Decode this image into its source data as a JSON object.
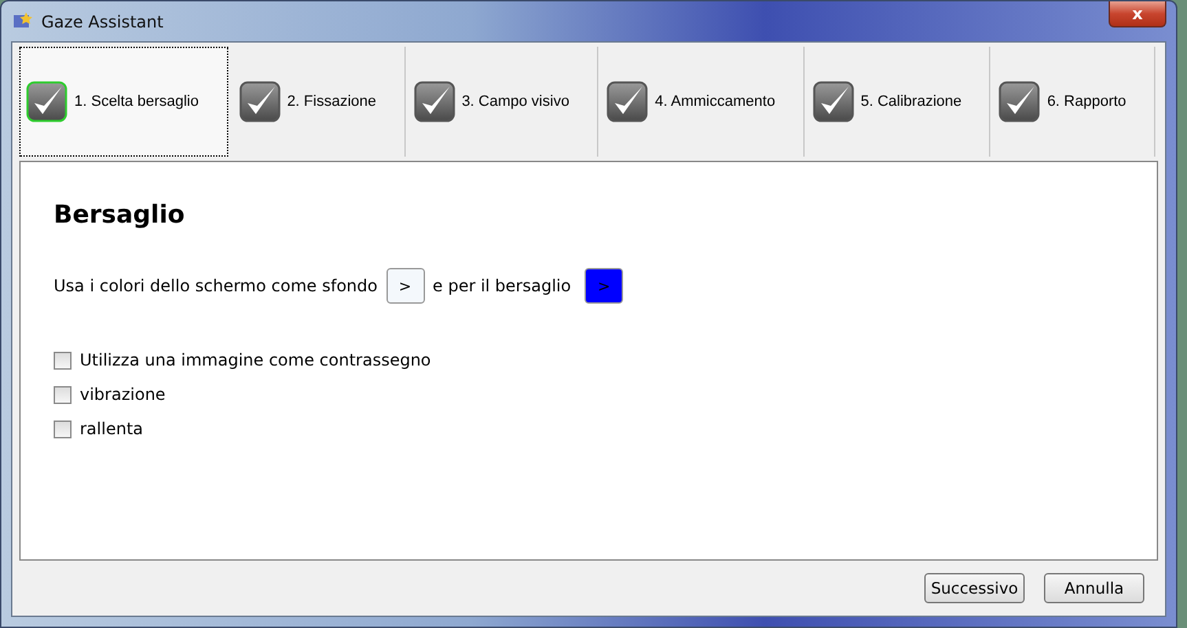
{
  "window": {
    "title": "Gaze Assistant",
    "close": "x"
  },
  "steps": [
    {
      "label": "1. Scelta bersaglio",
      "selected": true
    },
    {
      "label": "2. Fissazione",
      "selected": false
    },
    {
      "label": "3. Campo visivo",
      "selected": false
    },
    {
      "label": "4. Ammiccamento",
      "selected": false
    },
    {
      "label": "5. Calibrazione",
      "selected": false
    },
    {
      "label": "6. Rapporto",
      "selected": false
    }
  ],
  "heading": "Bersaglio",
  "color_row": {
    "text_before": "Usa i colori dello schermo come sfondo",
    "background_button": {
      "label": ">",
      "color": "#f4f8fc"
    },
    "text_middle": "e per il bersaglio",
    "target_button": {
      "label": ">",
      "color": "#0000ff"
    }
  },
  "options": [
    {
      "label": "Utilizza una immagine come contrassegno",
      "checked": false
    },
    {
      "label": "vibrazione",
      "checked": false
    },
    {
      "label": "rallenta",
      "checked": false
    }
  ],
  "buttons": [
    "Successivo",
    "Annulla"
  ]
}
